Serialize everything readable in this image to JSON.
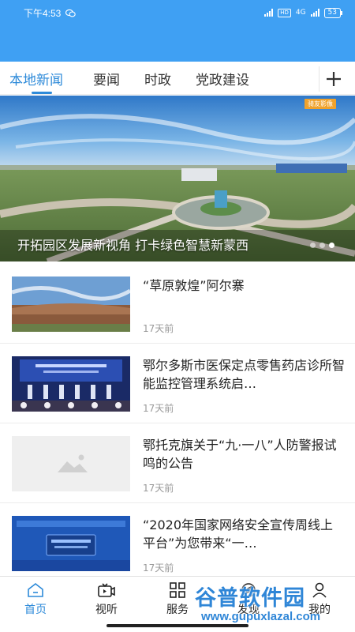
{
  "status_bar": {
    "time": "下午4:53",
    "network": "4G",
    "hd": "HD",
    "battery": "53"
  },
  "tabs": [
    {
      "label": "本地新闻",
      "active": true
    },
    {
      "label": "要闻",
      "active": false
    },
    {
      "label": "时政",
      "active": false
    },
    {
      "label": "党政建设",
      "active": false
    }
  ],
  "banner": {
    "badge": "骑友影像",
    "caption": "开拓园区发展新视角 打卡绿色智慧新蒙西",
    "slide_count": 3,
    "active_slide": 3
  },
  "news": [
    {
      "title": "“草原敦煌”阿尔寨",
      "time": "17天前",
      "thumb": "desert-landscape-photo"
    },
    {
      "title": "鄂尔多斯市医保定点零售药店诊所智能监控管理系统启…",
      "time": "17天前",
      "thumb": "conference-stage-photo"
    },
    {
      "title": "鄂托克旗关于“九·一八”人防警报试鸣的公告",
      "time": "17天前",
      "thumb": "image-placeholder-icon"
    },
    {
      "title": "“2020年国家网络安全宣传周线上平台”为您带来“一…",
      "time": "17天前",
      "thumb": "cybersecurity-poster"
    }
  ],
  "bottom_nav": [
    {
      "label": "首页",
      "icon": "home-icon",
      "active": true
    },
    {
      "label": "视听",
      "icon": "video-icon",
      "active": false
    },
    {
      "label": "服务",
      "icon": "grid-icon",
      "active": false
    },
    {
      "label": "发现",
      "icon": "discover-icon",
      "active": false
    },
    {
      "label": "我的",
      "icon": "user-icon",
      "active": false
    }
  ],
  "watermark": {
    "title": "谷普软件园",
    "url": "www.gupuxlazal.com"
  },
  "colors": {
    "header": "#3fa0f3",
    "accent": "#2d8ad9"
  }
}
